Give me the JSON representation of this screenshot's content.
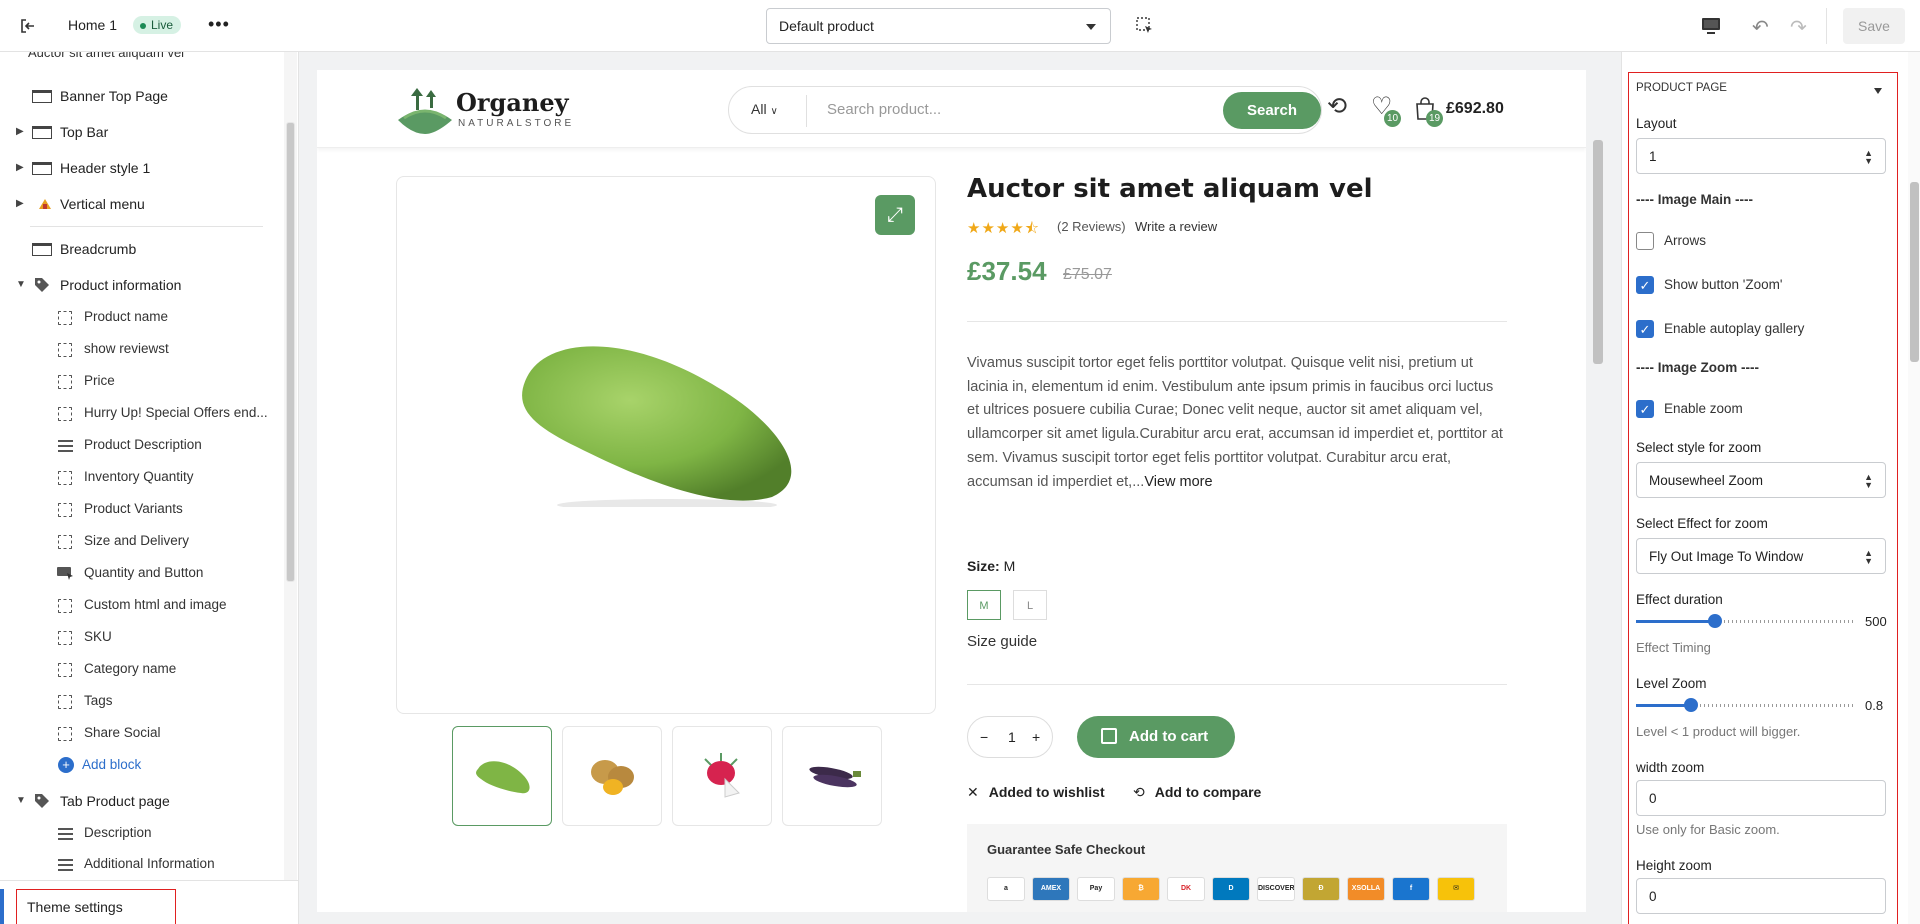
{
  "topbar": {
    "page_name": "Home 1",
    "status_badge": "Live",
    "template_select": "Default product",
    "save_label": "Save"
  },
  "left_panel": {
    "cut_title": "Auctor sit amet aliquam vel",
    "sections": [
      {
        "label": "Banner Top Page"
      },
      {
        "label": "Top Bar"
      },
      {
        "label": "Header style 1"
      },
      {
        "label": "Vertical menu"
      },
      {
        "label": "Breadcrumb"
      },
      {
        "label": "Product information"
      },
      {
        "label": "Tab Product page"
      }
    ],
    "product_info_blocks": [
      "Product name",
      "show reviewst",
      "Price",
      "Hurry Up! Special Offers end...",
      "Product Description",
      "Inventory Quantity",
      "Product Variants",
      "Size and Delivery",
      "Quantity and Button",
      "Custom html and image",
      "SKU",
      "Category name",
      "Tags",
      "Share Social"
    ],
    "add_block": "Add block",
    "tab_blocks": [
      "Description",
      "Additional Information"
    ],
    "theme_settings": "Theme settings"
  },
  "store": {
    "logo_name": "Organey",
    "logo_sub": "NATURALSTORE",
    "search_category": "All",
    "search_placeholder": "Search product...",
    "search_button": "Search",
    "wishlist_count": "10",
    "cart_count": "19",
    "cart_total": "£692.80"
  },
  "product": {
    "title": "Auctor sit amet aliquam vel",
    "stars": "★★★★⯪",
    "reviews": "(2 Reviews)",
    "write_review": "Write a review",
    "price": "£37.54",
    "old_price": "£75.07",
    "description": "Vivamus suscipit tortor eget felis porttitor volutpat. Quisque velit nisi, pretium ut lacinia in, elementum id enim. Vestibulum ante ipsum primis in faucibus orci luctus et ultrices posuere cubilia Curae; Donec velit neque, auctor sit amet aliquam vel, ullamcorper sit amet ligula.Curabitur arcu erat, accumsan id imperdiet et, porttitor at sem. Vivamus suscipit tortor eget felis porttitor volutpat. Curabitur arcu erat, accumsan id imperdiet et,...",
    "view_more": "View more",
    "size_label": "Size:",
    "size_value": "M",
    "sizes": [
      "M",
      "L"
    ],
    "size_guide": "Size guide",
    "quantity": "1",
    "add_to_cart": "Add to cart",
    "wishlist": "Added to wishlist",
    "compare": "Add to compare",
    "guarantee": "Guarantee Safe Checkout",
    "payments": [
      {
        "name": "a",
        "color": "#ffffff",
        "text_color": "#222"
      },
      {
        "name": "AMEX",
        "color": "#2e77bb",
        "text_color": "#fff"
      },
      {
        "name": "Pay",
        "color": "#ffffff",
        "text_color": "#222"
      },
      {
        "name": "₿",
        "color": "#f7a833",
        "text_color": "#fff"
      },
      {
        "name": "DK",
        "color": "#ffffff",
        "text_color": "#d9232a"
      },
      {
        "name": "D",
        "color": "#0079be",
        "text_color": "#fff"
      },
      {
        "name": "DISCOVER",
        "color": "#ffffff",
        "text_color": "#222"
      },
      {
        "name": "Ð",
        "color": "#c2a633",
        "text_color": "#fff"
      },
      {
        "name": "XSOLLA",
        "color": "#f28c28",
        "text_color": "#fff"
      },
      {
        "name": "f",
        "color": "#1a75cf",
        "text_color": "#fff"
      },
      {
        "name": "✉",
        "color": "#f7c20a",
        "text_color": "#222"
      }
    ]
  },
  "right_panel": {
    "section_title": "PRODUCT PAGE",
    "layout_label": "Layout",
    "layout_value": "1",
    "image_main_heading": "---- Image Main ----",
    "arrows": "Arrows",
    "show_zoom_button": "Show button 'Zoom'",
    "autoplay": "Enable autoplay gallery",
    "image_zoom_heading": "---- Image Zoom ----",
    "enable_zoom": "Enable zoom",
    "zoom_style_label": "Select style for zoom",
    "zoom_style_value": "Mousewheel Zoom",
    "zoom_effect_label": "Select Effect for zoom",
    "zoom_effect_value": "Fly Out Image To Window",
    "effect_duration_label": "Effect duration",
    "effect_duration_value": "500",
    "effect_duration_fraction": 0.36,
    "effect_timing": "Effect Timing",
    "level_zoom_label": "Level Zoom",
    "level_zoom_value": "0.8",
    "level_zoom_fraction": 0.25,
    "level_zoom_help": "Level < 1 product will bigger.",
    "width_zoom_label": "width zoom",
    "width_zoom_value": "0",
    "width_zoom_help": "Use only for Basic zoom.",
    "height_zoom_label": "Height zoom",
    "height_zoom_value": "0"
  },
  "colors": {
    "brand_green": "#5a9a63",
    "accent_blue": "#2c6ecb",
    "highlight_red": "#e02020"
  }
}
